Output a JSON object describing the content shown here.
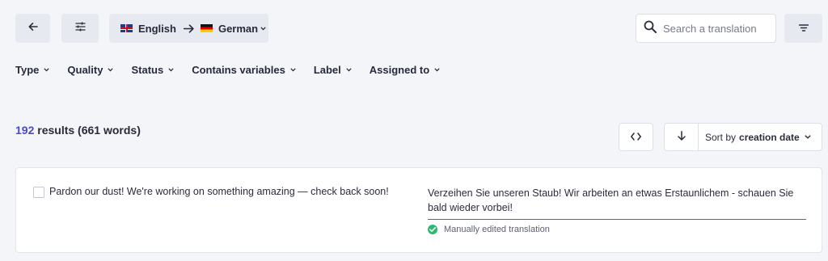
{
  "toolbar": {
    "source_language": "English",
    "target_language": "German",
    "icons": {
      "back": "arrow-left-icon",
      "settings": "sliders-icon",
      "filter": "filter-lines-icon",
      "search": "search-icon"
    }
  },
  "search": {
    "placeholder": "Search a translation",
    "value": ""
  },
  "filters": [
    {
      "label": "Type"
    },
    {
      "label": "Quality"
    },
    {
      "label": "Status"
    },
    {
      "label": "Contains variables"
    },
    {
      "label": "Label"
    },
    {
      "label": "Assigned to"
    }
  ],
  "results": {
    "count": "192",
    "suffix": "results (661 words)"
  },
  "sort": {
    "prefix": "Sort by",
    "value": "creation date"
  },
  "translations": [
    {
      "source": "Pardon our dust! We're working on something amazing — check back soon!",
      "target": "Verzeihen Sie unseren Staub! Wir arbeiten an etwas Erstaunlichem - schauen Sie bald wieder vorbei!",
      "status": "Manually edited translation",
      "checked": false
    }
  ],
  "colors": {
    "accent": "#4a47d1",
    "status_ok": "#2eb872",
    "background": "#f4f5f9"
  }
}
